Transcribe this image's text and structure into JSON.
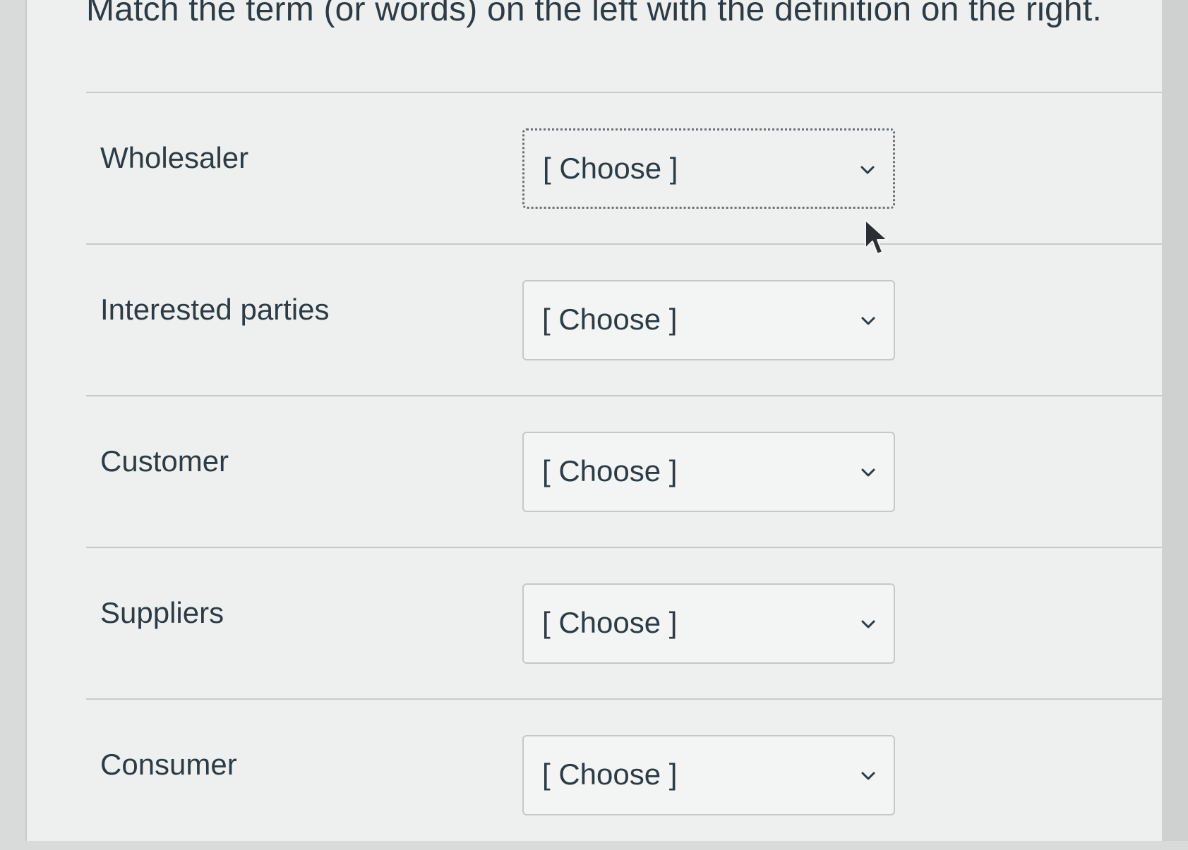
{
  "question": {
    "text": "Match the term (or words) on the left with the definition on the right."
  },
  "rows": [
    {
      "term": "Wholesaler",
      "selected": "[ Choose ]"
    },
    {
      "term": "Interested parties",
      "selected": "[ Choose ]"
    },
    {
      "term": "Customer",
      "selected": "[ Choose ]"
    },
    {
      "term": "Suppliers",
      "selected": "[ Choose ]"
    },
    {
      "term": "Consumer",
      "selected": "[ Choose ]"
    }
  ],
  "icons": {
    "dropdown": "chevron-down-icon",
    "pointer": "mouse-cursor-icon"
  },
  "colors": {
    "text": "#2d3b45",
    "divider": "#c7cacb",
    "select_border": "#c4c8ca",
    "focus_border": "#6b7075",
    "background": "#eef0ef"
  }
}
